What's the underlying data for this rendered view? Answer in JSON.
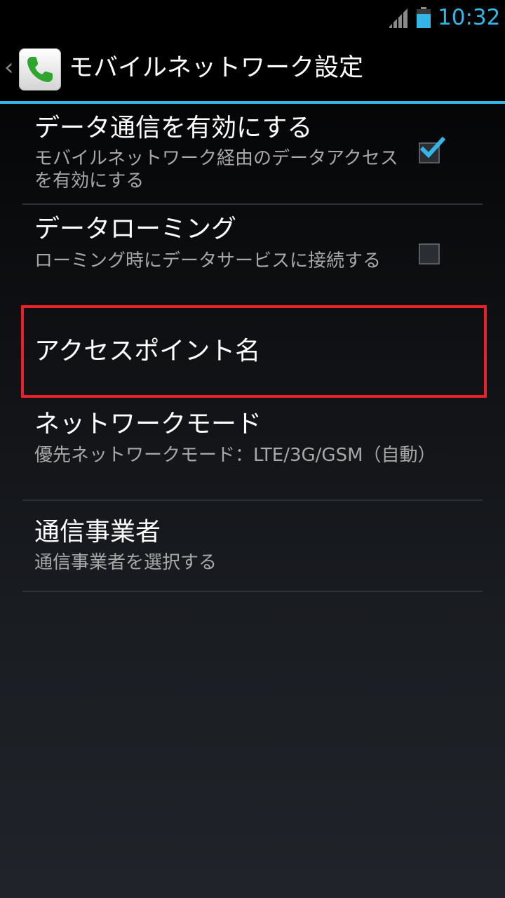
{
  "status_bar": {
    "time": "10:32",
    "signal_icon": "signal-icon",
    "battery_icon": "battery-icon",
    "accent_color": "#33b5e5"
  },
  "action_bar": {
    "title": "モバイルネットワーク設定",
    "up_icon": "chevron-left-icon",
    "app_icon": "phone-icon"
  },
  "preferences": [
    {
      "title": "データ通信を有効にする",
      "summary": "モバイルネットワーク経由のデータアクセスを有効にする",
      "checked": true
    },
    {
      "title": "データローミング",
      "summary": "ローミング時にデータサービスに接続する",
      "checked": false
    },
    {
      "title": "アクセスポイント名"
    },
    {
      "title": "ネットワークモード",
      "summary": "優先ネットワークモード：LTE/3G/GSM（自動）"
    },
    {
      "title": "通信事業者",
      "summary": "通信事業者を選択する"
    }
  ],
  "highlight_color": "#e8212b"
}
